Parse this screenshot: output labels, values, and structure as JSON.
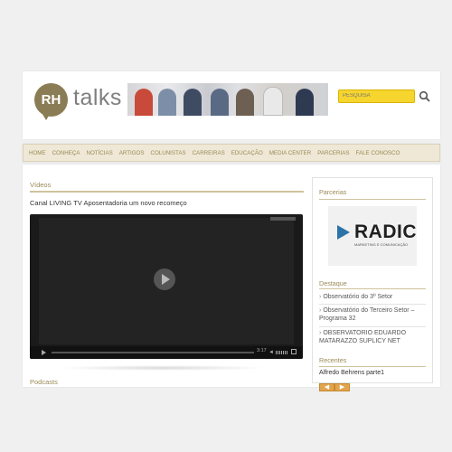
{
  "header": {
    "logo_mark": "RH",
    "logo_word": "talks",
    "search_placeholder": "PESQUISA"
  },
  "nav": {
    "items": [
      "HOME",
      "CONHEÇA",
      "NOTÍCIAS",
      "ARTIGOS",
      "COLUNISTAS",
      "CARREIRAS",
      "EDUCAÇÃO",
      "MEDIA CENTER",
      "PARCERIAS",
      "FALE CONOSCO"
    ]
  },
  "main": {
    "videos_title": "Vídeos",
    "video_title": "Canal LIVING TV Aposentadoria um novo recomeço",
    "player": {
      "time": "3:17"
    },
    "podcasts_title": "Podcasts"
  },
  "sidebar": {
    "partners_title": "Parcerias",
    "partner_logo": "RADIC",
    "partner_tagline": "MARKETING E COMUNICAÇÃO",
    "highlights_title": "Destaque",
    "highlights": [
      "Observatório do 3º Setor",
      "Observatório do Terceiro Setor – Programa 32",
      "OBSERVATORIO EDUARDO MATARAZZO SUPLICY NET"
    ],
    "recent_title": "Recentes",
    "recent_item": "Alfredo Behrens parte1",
    "prev_label": "◀",
    "next_label": "▶"
  },
  "colors": {
    "accent": "#9a8a56",
    "search_bg": "#f6d52e",
    "arrow_btn": "#e2a44c"
  }
}
